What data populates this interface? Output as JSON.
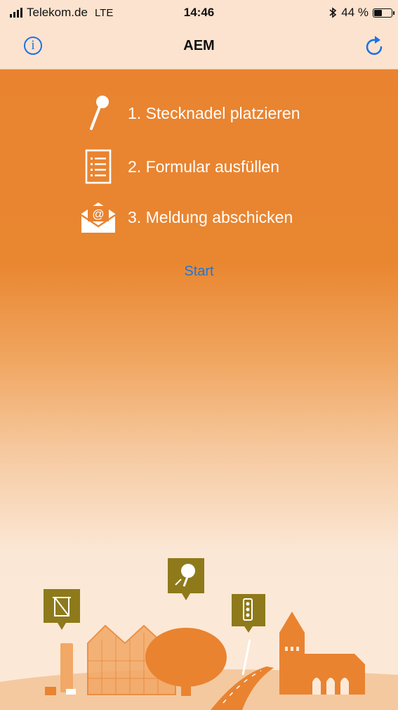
{
  "status_bar": {
    "carrier": "Telekom.de",
    "network": "LTE",
    "time": "14:46",
    "battery_percent": "44 %",
    "battery_level": 0.44,
    "icons": [
      "signal-icon",
      "bluetooth-icon",
      "battery-icon"
    ]
  },
  "nav_bar": {
    "title": "AEM",
    "left_icon": "info-icon",
    "right_icon": "refresh-icon"
  },
  "steps": [
    {
      "label": "1. Stecknadel platzieren",
      "icon": "pin-icon"
    },
    {
      "label": "2. Formular ausfüllen",
      "icon": "form-icon"
    },
    {
      "label": "3. Meldung abschicken",
      "icon": "mail-icon"
    }
  ],
  "start_label": "Start",
  "colors": {
    "accent": "#1b73e8",
    "orange": "#e98330",
    "bar_bg": "#fce3cf"
  },
  "illustration": [
    "trash-bin-icon",
    "tree-icon",
    "traffic-light-icon",
    "church",
    "greenhouse",
    "road"
  ]
}
